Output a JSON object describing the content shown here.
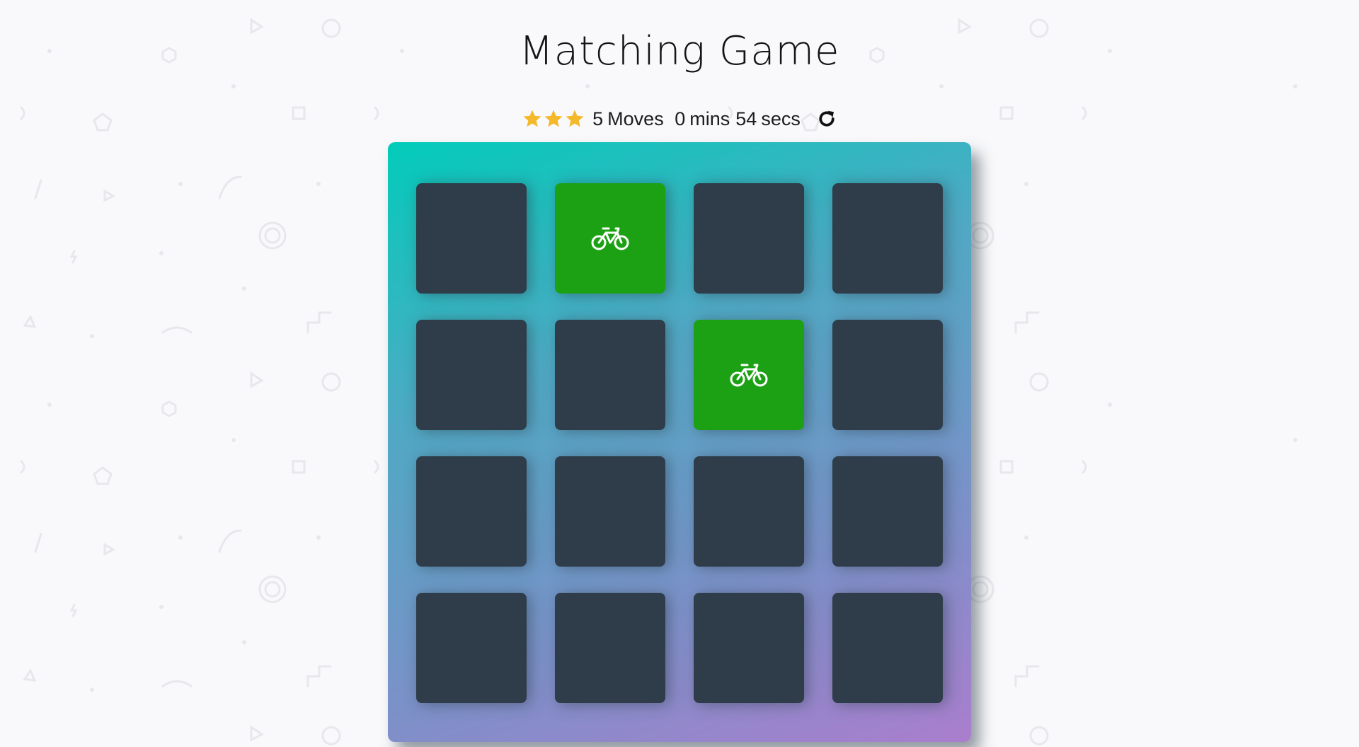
{
  "page": {
    "title": "Matching Game"
  },
  "score_panel": {
    "stars": 3,
    "moves": "5",
    "moves_label": "Moves",
    "mins": "0",
    "mins_label": "mins",
    "secs": "54",
    "secs_label": "secs",
    "restart_icon": "redo-icon"
  },
  "colors": {
    "star": "#f4b92b",
    "card_back": "#2e3d49",
    "card_match": "#1da114",
    "deck_gradient_start": "#02ccba",
    "deck_gradient_end": "#aa7ecd"
  },
  "deck": {
    "cards": [
      {
        "state": "hidden",
        "icon": ""
      },
      {
        "state": "match",
        "icon": "bicycle-icon"
      },
      {
        "state": "hidden",
        "icon": ""
      },
      {
        "state": "hidden",
        "icon": ""
      },
      {
        "state": "hidden",
        "icon": ""
      },
      {
        "state": "hidden",
        "icon": ""
      },
      {
        "state": "match",
        "icon": "bicycle-icon"
      },
      {
        "state": "hidden",
        "icon": ""
      },
      {
        "state": "hidden",
        "icon": ""
      },
      {
        "state": "hidden",
        "icon": ""
      },
      {
        "state": "hidden",
        "icon": ""
      },
      {
        "state": "hidden",
        "icon": ""
      },
      {
        "state": "hidden",
        "icon": ""
      },
      {
        "state": "hidden",
        "icon": ""
      },
      {
        "state": "hidden",
        "icon": ""
      },
      {
        "state": "hidden",
        "icon": ""
      }
    ]
  }
}
